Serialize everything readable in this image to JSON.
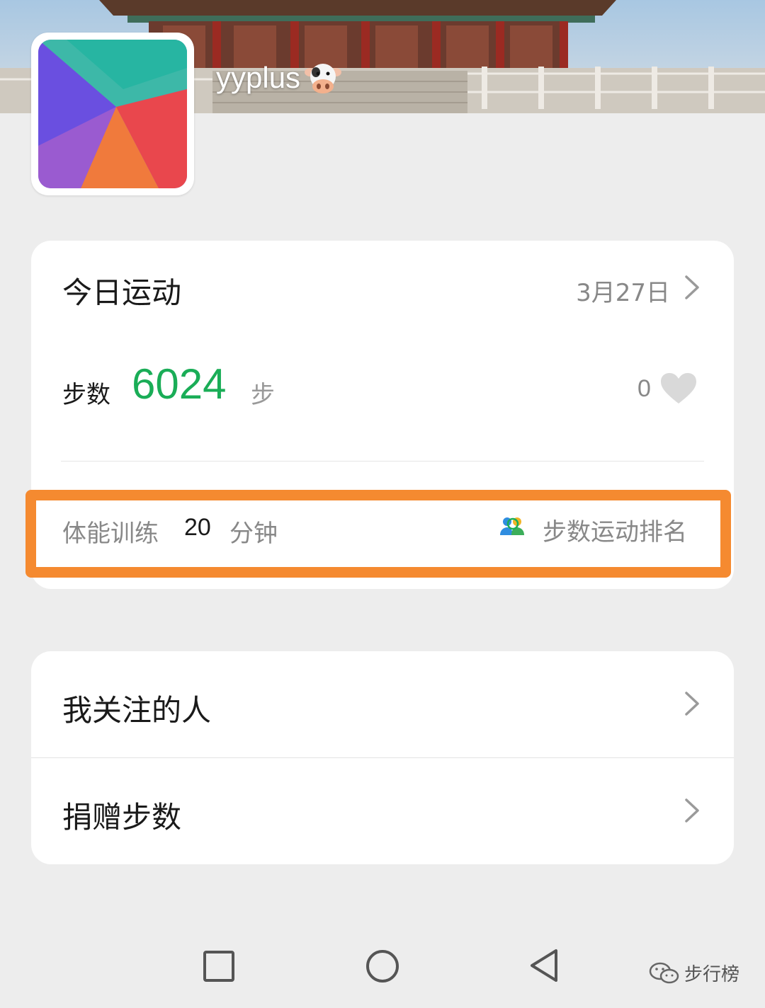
{
  "profile": {
    "username": "yyplus",
    "avatar_icon": "avatar-wallpaper-icon",
    "emoji_icon": "cow-face-icon"
  },
  "today": {
    "title": "今日运动",
    "date": "3月27日",
    "steps_label": "步数",
    "steps_value": "6024",
    "steps_unit": "步",
    "likes": "0",
    "training_label": "体能训练",
    "training_value": "20",
    "training_unit": "分钟",
    "ranking_label": "步数运动排名"
  },
  "menu": {
    "items": [
      {
        "label": "我关注的人"
      },
      {
        "label": "捐赠步数"
      }
    ]
  },
  "watermark": {
    "text": "步行榜"
  },
  "colors": {
    "accent_green": "#1aad57",
    "highlight_orange": "#f58a30"
  }
}
